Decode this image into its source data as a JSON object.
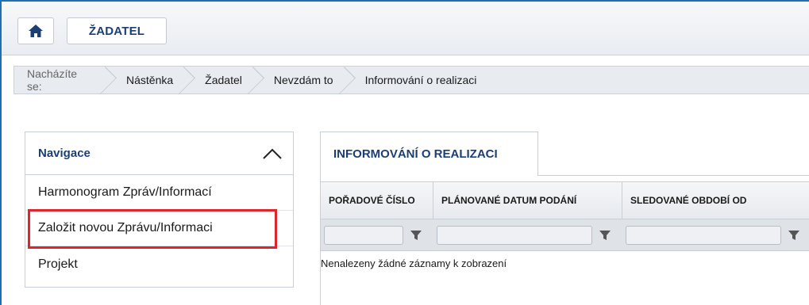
{
  "header": {
    "role_button": "ŽADATEL",
    "home_icon": "home-icon"
  },
  "breadcrumb": {
    "prefix": "Nacházíte se:",
    "items": [
      "Nástěnka",
      "Žadatel",
      "Nevzdám to",
      "Informování o realizaci"
    ]
  },
  "navigation": {
    "title": "Navigace",
    "toggle_icon": "chevron-up-icon",
    "items": [
      "Harmonogram Zpráv/Informací",
      "Založit novou Zprávu/Informaci",
      "Projekt"
    ],
    "highlight_color": "#e0242c"
  },
  "tab": {
    "label": "INFORMOVÁNÍ O REALIZACI"
  },
  "table": {
    "columns": [
      "POŘADOVÉ ČÍSLO",
      "PLÁNOVANÉ DATUM PODÁNÍ",
      "SLEDOVANÉ OBDOBÍ OD"
    ],
    "filter_icon": "filter-icon",
    "empty_message": "Nenalezeny žádné záznamy k zobrazení"
  },
  "colors": {
    "accent": "#1b3f74",
    "frame": "#1f6fb5"
  }
}
